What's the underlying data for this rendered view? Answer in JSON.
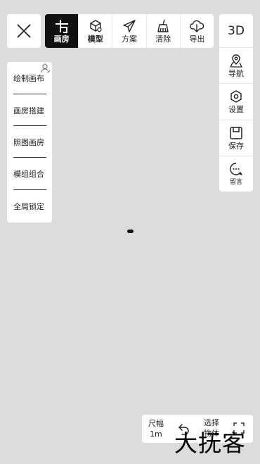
{
  "close_button": {
    "icon": "close-icon"
  },
  "toolbar": {
    "tools": [
      {
        "label": "画房",
        "icon": "draw-room-icon",
        "active": true
      },
      {
        "label": "模型",
        "icon": "cube-icon",
        "active": false
      },
      {
        "label": "方案",
        "icon": "paper-plane-icon",
        "active": false
      },
      {
        "label": "清除",
        "icon": "broom-icon",
        "active": false
      },
      {
        "label": "导出",
        "icon": "cloud-download-icon",
        "active": false
      }
    ]
  },
  "right_panel": {
    "view_toggle": "3D",
    "items": [
      {
        "label": "导航",
        "icon": "location-pin-icon"
      },
      {
        "label": "设置",
        "icon": "hexagon-settings-icon"
      },
      {
        "label": "保存",
        "icon": "save-icon"
      },
      {
        "label": "留言",
        "icon": "message-icon"
      }
    ]
  },
  "left_menu": {
    "items": [
      "绘制画布",
      "画房搭建",
      "照图画房",
      "模组组合",
      "全局锁定"
    ]
  },
  "bottom_bar": {
    "scale_label": "尺幅",
    "scale_value": "1m",
    "select_label": "选择物体"
  },
  "watermark": "大抚客",
  "colors": {
    "background": "#dcdcdc",
    "panel": "#ffffff",
    "active_tool": "#111111"
  }
}
